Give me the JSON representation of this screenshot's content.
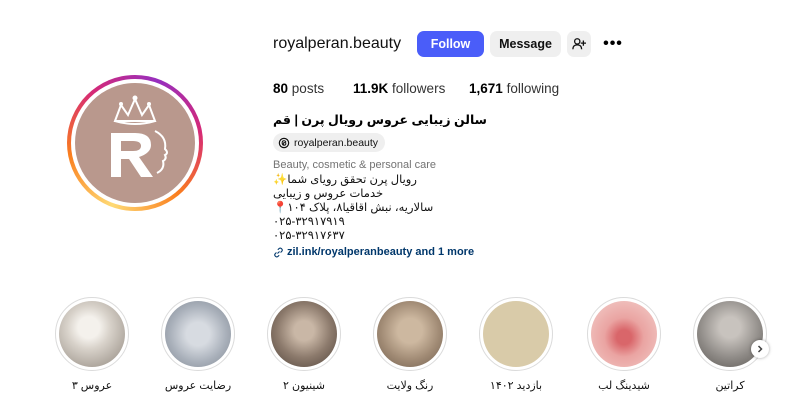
{
  "profile": {
    "username": "royalperan.beauty",
    "follow_label": "Follow",
    "message_label": "Message",
    "more_label": "•••",
    "stats": {
      "posts_count": "80",
      "posts_label": "posts",
      "followers_count": "11.9K",
      "followers_label": "followers",
      "following_count": "1,671",
      "following_label": "following"
    },
    "full_name": "سالن زیبایی عروس رویال پرن | قم",
    "threads_handle": "royalperan.beauty",
    "category": "Beauty, cosmetic & personal care",
    "bio_lines": [
      "رویال پرن تحقق رویای شما✨",
      "خدمات عروس و زیبایی",
      "سالاریه، نبش اقاقیا۸، پلاک ۱۰۴📍",
      "۰۲۵-۳۲۹۱۷۹۱۹",
      "۰۲۵-۳۲۹۱۷۶۳۷"
    ],
    "link_text": "zil.ink/royalperanbeauty and 1 more"
  },
  "highlights": [
    {
      "label": "عروس ۳",
      "color": "#c9c3bb"
    },
    {
      "label": "رضایت عروس",
      "color": "#aeb4bd"
    },
    {
      "label": "شینیون ۲",
      "color": "#8c7a6c"
    },
    {
      "label": "رنگ ولایت",
      "color": "#a08a74"
    },
    {
      "label": "بازدید ۱۴۰۲",
      "color": "#d6c8a8"
    },
    {
      "label": "شیدینگ لب",
      "color": "#e6a8a4"
    },
    {
      "label": "کراتین",
      "color": "#8e8a86"
    }
  ],
  "colors": {
    "follow_blue": "#4a5df9",
    "avatar_bg": "#b9988d",
    "link_color": "#00376b"
  }
}
